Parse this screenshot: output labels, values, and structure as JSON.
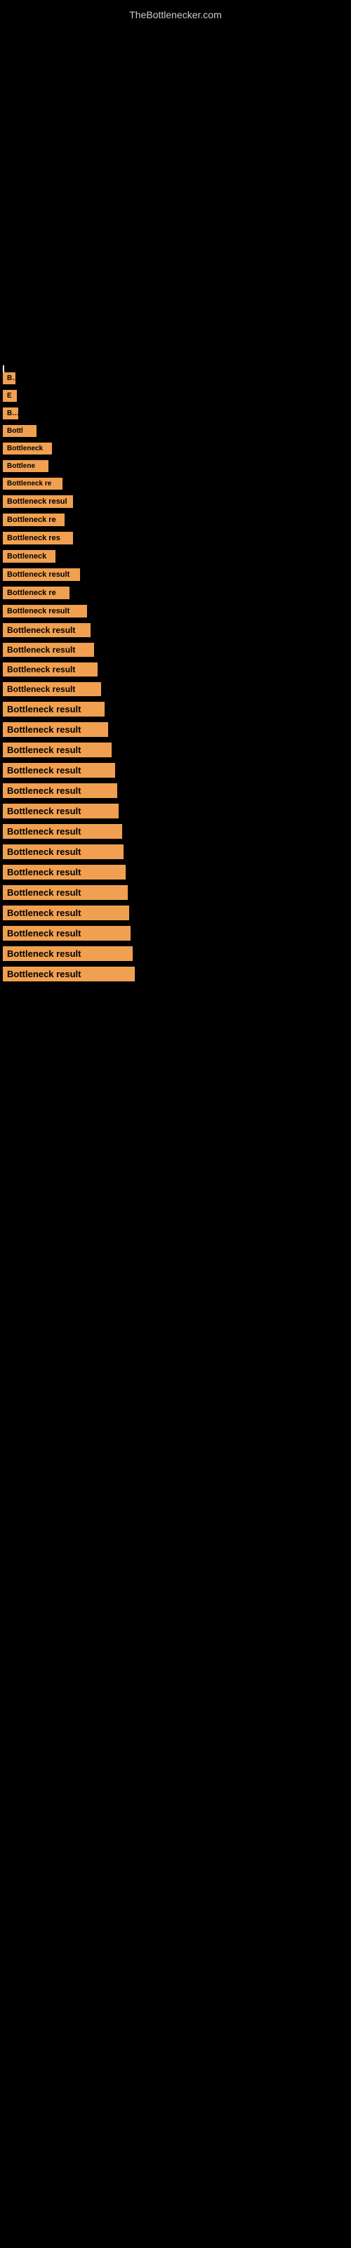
{
  "site": {
    "title": "TheBottlenecker.com"
  },
  "results": [
    {
      "label": "B"
    },
    {
      "label": "E"
    },
    {
      "label": "Bo"
    },
    {
      "label": "Bottl"
    },
    {
      "label": "Bottleneck"
    },
    {
      "label": "Bottlene"
    },
    {
      "label": "Bottleneck re"
    },
    {
      "label": "Bottleneck resul"
    },
    {
      "label": "Bottleneck re"
    },
    {
      "label": "Bottleneck res"
    },
    {
      "label": "Bottleneck"
    },
    {
      "label": "Bottleneck result"
    },
    {
      "label": "Bottleneck re"
    },
    {
      "label": "Bottleneck result"
    },
    {
      "label": "Bottleneck result"
    },
    {
      "label": "Bottleneck result"
    },
    {
      "label": "Bottleneck result"
    },
    {
      "label": "Bottleneck result"
    },
    {
      "label": "Bottleneck result"
    },
    {
      "label": "Bottleneck result"
    },
    {
      "label": "Bottleneck result"
    },
    {
      "label": "Bottleneck result"
    },
    {
      "label": "Bottleneck result"
    },
    {
      "label": "Bottleneck result"
    },
    {
      "label": "Bottleneck result"
    },
    {
      "label": "Bottleneck result"
    },
    {
      "label": "Bottleneck result"
    },
    {
      "label": "Bottleneck result"
    },
    {
      "label": "Bottleneck result"
    },
    {
      "label": "Bottleneck result"
    },
    {
      "label": "Bottleneck result"
    },
    {
      "label": "Bottleneck result"
    }
  ]
}
